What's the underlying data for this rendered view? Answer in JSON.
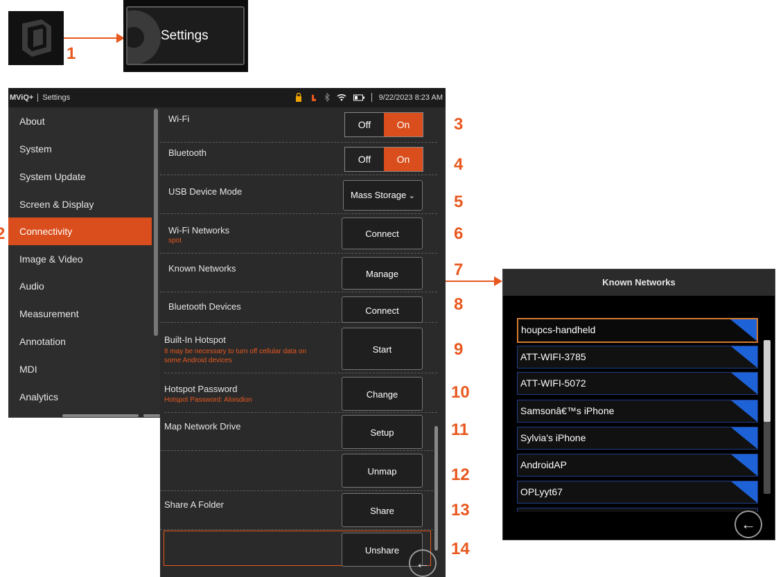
{
  "top": {
    "settings_tile_label": "Settings",
    "step1": "1"
  },
  "statusbar": {
    "app_name": "MViQ+",
    "section": "Settings",
    "datetime": "9/22/2023 8:23 AM",
    "accent_color": "#e8581e"
  },
  "sidebar": {
    "items": [
      {
        "label": "About"
      },
      {
        "label": "System"
      },
      {
        "label": "System Update"
      },
      {
        "label": "Screen & Display"
      },
      {
        "label": "Connectivity",
        "active": true
      },
      {
        "label": "Image & Video"
      },
      {
        "label": "Audio"
      },
      {
        "label": "Measurement"
      },
      {
        "label": "Annotation"
      },
      {
        "label": "MDI"
      },
      {
        "label": "Analytics"
      }
    ],
    "step2": "2"
  },
  "settings": {
    "wifi": {
      "label": "Wi-Fi",
      "off": "Off",
      "on": "On",
      "step": "3"
    },
    "bluetooth": {
      "label": "Bluetooth",
      "off": "Off",
      "on": "On",
      "step": "4"
    },
    "usb": {
      "label": "USB Device Mode",
      "value": "Mass Storage",
      "step": "5"
    },
    "wifi_networks": {
      "label": "Wi-Fi Networks",
      "sub": "spot",
      "button": "Connect",
      "step": "6"
    },
    "known_networks": {
      "label": "Known Networks",
      "button": "Manage",
      "step": "7"
    },
    "bt_devices": {
      "label": "Bluetooth Devices",
      "button": "Connect",
      "step": "8"
    },
    "hotspot": {
      "label": "Built-In Hotspot",
      "sub1": "It may be necessary to turn off cellular data on",
      "sub2": "some Android devices",
      "button": "Start",
      "step": "9"
    },
    "hotspot_pw": {
      "label": "Hotspot Password",
      "sub": "Hotspot Password: Aloisdion",
      "button": "Change",
      "step": "10"
    },
    "map_drive": {
      "label": "Map Network Drive",
      "button": "Setup",
      "step": "11"
    },
    "unmap": {
      "button": "Unmap",
      "step": "12"
    },
    "share": {
      "label": "Share A Folder",
      "button": "Share",
      "step": "13"
    },
    "unshare": {
      "button": "Unshare",
      "step": "14"
    }
  },
  "known_networks_panel": {
    "title": "Known Networks",
    "networks": [
      "houpcs-handheld",
      "ATT-WIFI-3785",
      "ATT-WIFI-5072",
      "Samsonâ€™s iPhone",
      "Sylvia's iPhone",
      "AndroidAP",
      "OPLyyt67"
    ]
  }
}
